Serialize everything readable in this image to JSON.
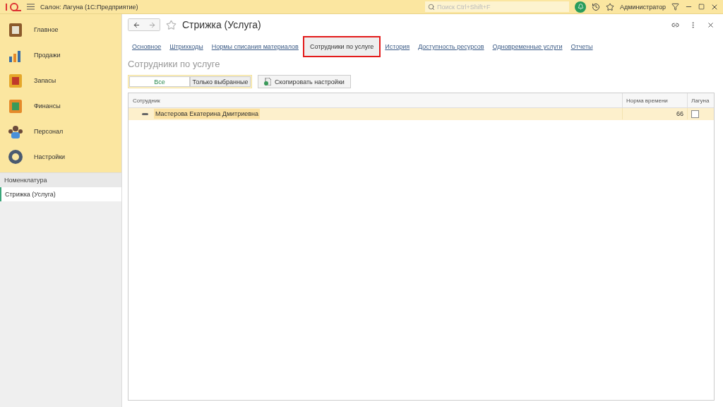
{
  "titlebar": {
    "title": "Салон: Лагуна  (1С:Предприятие)",
    "search": {
      "placeholder": "Поиск Ctrl+Shift+F"
    },
    "user": "Администратор"
  },
  "sidebar": {
    "sections": [
      {
        "label": "Главное"
      },
      {
        "label": "Продажи"
      },
      {
        "label": "Запасы"
      },
      {
        "label": "Финансы"
      },
      {
        "label": "Персонал"
      },
      {
        "label": "Настройки"
      }
    ],
    "history": {
      "title": "Номенклатура",
      "items": [
        {
          "label": "Стрижка (Услуга)",
          "selected": true
        }
      ]
    }
  },
  "form": {
    "title": "Стрижка (Услуга)",
    "tabs": [
      {
        "label": "Основное",
        "selected": false,
        "highlighted": false
      },
      {
        "label": "Штрихкоды",
        "selected": false,
        "highlighted": false
      },
      {
        "label": "Нормы списания материалов",
        "selected": false,
        "highlighted": false
      },
      {
        "label": "Сотрудники по услуге",
        "selected": true,
        "highlighted": true
      },
      {
        "label": "История",
        "selected": false,
        "highlighted": false
      },
      {
        "label": "Доступность ресурсов",
        "selected": false,
        "highlighted": false
      },
      {
        "label": "Одновременные услуги",
        "selected": false,
        "highlighted": false
      },
      {
        "label": "Отчеты",
        "selected": false,
        "highlighted": false
      }
    ],
    "section_title": "Сотрудники по услуге",
    "filter": [
      {
        "label": "Все",
        "selected": true
      },
      {
        "label": "Только выбранные",
        "selected": false
      }
    ],
    "copy_button": "Скопировать настройки",
    "table": {
      "columns": [
        "Сотрудник",
        "Норма времени",
        "Лагуна"
      ],
      "rows": [
        {
          "name": "Мастерова Екатерина Дмитриевна",
          "norm": "66",
          "checked": false,
          "selected": true
        }
      ]
    }
  }
}
